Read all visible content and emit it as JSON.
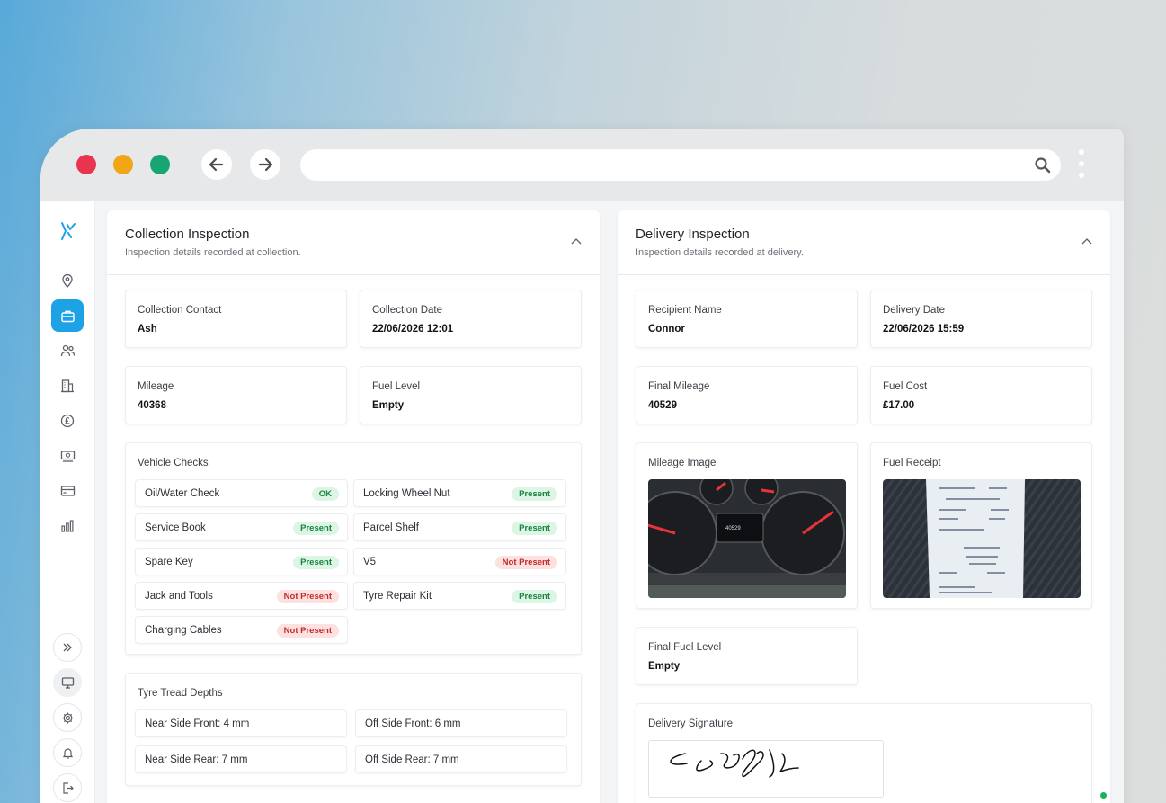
{
  "colors": {
    "accent": "#1ea2e6",
    "ok_badge": "#dcf5e4",
    "bad_badge": "#fde1e1"
  },
  "browser": {
    "icons": [
      "back-arrow-icon",
      "forward-arrow-icon",
      "search-icon",
      "kebab-icon"
    ]
  },
  "sidebar": {
    "items": [
      "location-pin-icon",
      "briefcase-icon",
      "users-icon",
      "building-icon",
      "pound-icon",
      "cash-icon",
      "card-icon",
      "bar-chart-icon"
    ],
    "bottom": [
      "expand-icon",
      "monitor-icon",
      "gear-icon",
      "bell-icon",
      "logout-icon"
    ]
  },
  "collection": {
    "title": "Collection Inspection",
    "subtitle": "Inspection details recorded at collection.",
    "contact_label": "Collection Contact",
    "contact_value": "Ash",
    "date_label": "Collection Date",
    "date_value": "22/06/2026 12:01",
    "mileage_label": "Mileage",
    "mileage_value": "40368",
    "fuel_label": "Fuel Level",
    "fuel_value": "Empty",
    "checks_title": "Vehicle Checks",
    "checks": [
      {
        "name": "Oil/Water Check",
        "status": "OK",
        "ok": true
      },
      {
        "name": "Locking Wheel Nut",
        "status": "Present",
        "ok": true
      },
      {
        "name": "Service Book",
        "status": "Present",
        "ok": true
      },
      {
        "name": "Parcel Shelf",
        "status": "Present",
        "ok": true
      },
      {
        "name": "Spare Key",
        "status": "Present",
        "ok": true
      },
      {
        "name": "V5",
        "status": "Not Present",
        "ok": false
      },
      {
        "name": "Jack and Tools",
        "status": "Not Present",
        "ok": false
      },
      {
        "name": "Tyre Repair Kit",
        "status": "Present",
        "ok": true
      },
      {
        "name": "Charging Cables",
        "status": "Not Present",
        "ok": false
      }
    ],
    "tyre_title": "Tyre Tread Depths",
    "tyres": [
      "Near Side Front: 4 mm",
      "Off Side Front: 6 mm",
      "Near Side Rear: 7 mm",
      "Off Side Rear: 7 mm"
    ]
  },
  "delivery": {
    "title": "Delivery Inspection",
    "subtitle": "Inspection details recorded at delivery.",
    "recipient_label": "Recipient Name",
    "recipient_value": "Connor",
    "date_label": "Delivery Date",
    "date_value": "22/06/2026 15:59",
    "mileage_label": "Final Mileage",
    "mileage_value": "40529",
    "cost_label": "Fuel Cost",
    "cost_value": "£17.00",
    "mileage_image_label": "Mileage Image",
    "receipt_label": "Fuel Receipt",
    "final_fuel_label": "Final Fuel Level",
    "final_fuel_value": "Empty",
    "signature_label": "Delivery Signature"
  }
}
